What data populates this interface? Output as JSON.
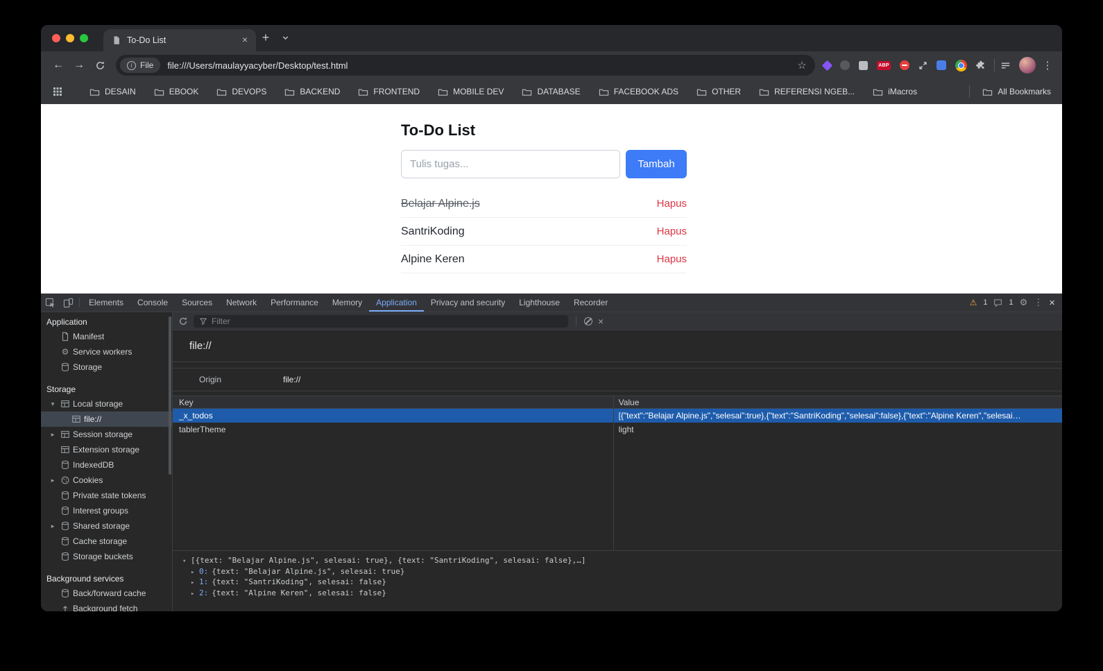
{
  "colors": {
    "accent": "#3d7bf7",
    "danger": "#dc3545",
    "devtools_accent": "#7cacf8",
    "devtools_selection": "#1e5cab",
    "sidebar_selection": "#3f4650"
  },
  "icons": {
    "back": "←",
    "forward": "→",
    "plus": "+",
    "close": "×",
    "star": "☆",
    "info": "i",
    "kebab": "⋮",
    "gear": "⚙",
    "warning": "⚠",
    "expander_open": "▾",
    "expander_closed": "▸"
  },
  "browser": {
    "tab_title": "To-Do List",
    "url_chip_label": "File",
    "url": "file:///Users/maulayyacyber/Desktop/test.html",
    "abp_badge": "ABP",
    "bookmarks": [
      "DESAIN",
      "EBOOK",
      "DEVOPS",
      "BACKEND",
      "FRONTEND",
      "MOBILE DEV",
      "DATABASE",
      "FACEBOOK ADS",
      "OTHER",
      "REFERENSI NGEB...",
      "iMacros"
    ],
    "all_bookmarks_label": "All Bookmarks"
  },
  "page": {
    "title": "To-Do List",
    "input_placeholder": "Tulis tugas...",
    "add_button_label": "Tambah",
    "delete_label": "Hapus",
    "todos": [
      {
        "text": "Belajar Alpine.js",
        "completed": true
      },
      {
        "text": "SantriKoding",
        "completed": false
      },
      {
        "text": "Alpine Keren",
        "completed": false
      }
    ]
  },
  "devtools": {
    "tabs": [
      "Elements",
      "Console",
      "Sources",
      "Network",
      "Performance",
      "Memory",
      "Application",
      "Privacy and security",
      "Lighthouse",
      "Recorder"
    ],
    "active_tab": "Application",
    "warning_count": "1",
    "message_count": "1",
    "filter_placeholder": "Filter",
    "sidebar": {
      "application_section": "Application",
      "application_items": [
        "Manifest",
        "Service workers",
        "Storage"
      ],
      "storage_section": "Storage",
      "local_storage_label": "Local storage",
      "local_storage_origin": "file://",
      "storage_items": [
        "Session storage",
        "Extension storage",
        "IndexedDB",
        "Cookies",
        "Private state tokens",
        "Interest groups",
        "Shared storage",
        "Cache storage",
        "Storage buckets"
      ],
      "background_section": "Background services",
      "background_items": [
        "Back/forward cache",
        "Background fetch"
      ]
    },
    "storage_panel": {
      "origin_title": "file://",
      "origin_label": "Origin",
      "origin_value": "file://",
      "key_header": "Key",
      "value_header": "Value",
      "rows": [
        {
          "key": "_x_todos",
          "value": "[{\"text\":\"Belajar Alpine.js\",\"selesai\":true},{\"text\":\"SantriKoding\",\"selesai\":false},{\"text\":\"Alpine Keren\",\"selesai…"
        },
        {
          "key": "tablerTheme",
          "value": "light"
        }
      ],
      "preview": {
        "root": "[{text: \"Belajar Alpine.js\", selesai: true}, {text: \"SantriKoding\", selesai: false},…]",
        "items": [
          {
            "index": "0:",
            "value": "{text: \"Belajar Alpine.js\", selesai: true}"
          },
          {
            "index": "1:",
            "value": "{text: \"SantriKoding\", selesai: false}"
          },
          {
            "index": "2:",
            "value": "{text: \"Alpine Keren\", selesai: false}"
          }
        ]
      }
    }
  }
}
